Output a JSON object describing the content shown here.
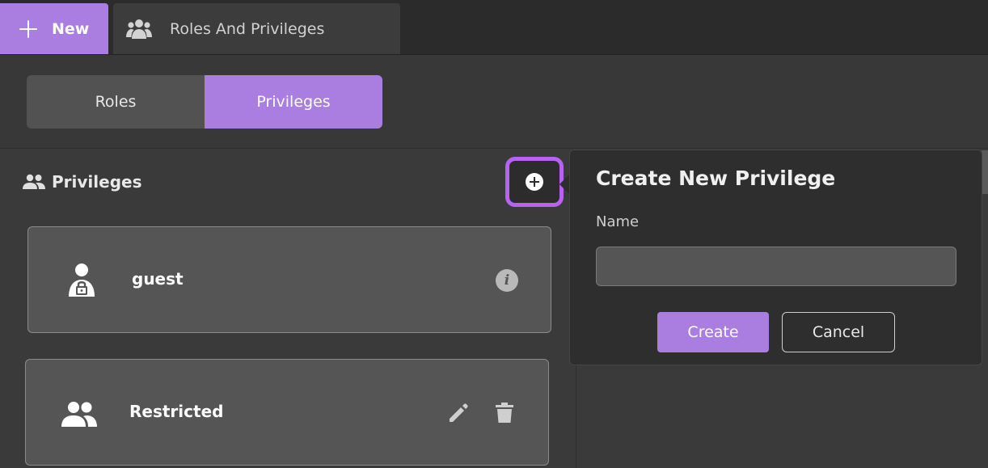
{
  "topbar": {
    "new_label": "New",
    "tab_label": "Roles And Privileges"
  },
  "segment": {
    "roles_label": "Roles",
    "privileges_label": "Privileges",
    "active": "Privileges"
  },
  "panel": {
    "title": "Privileges",
    "items": [
      {
        "label": "guest",
        "icon": "user-lock-icon",
        "actions": [
          "info-icon"
        ]
      },
      {
        "label": "Restricted",
        "icon": "people-icon",
        "actions": [
          "edit-icon",
          "trash-icon"
        ]
      }
    ]
  },
  "popover": {
    "title": "Create New Privilege",
    "name_label": "Name",
    "name_value": "",
    "create_label": "Create",
    "cancel_label": "Cancel"
  },
  "colors": {
    "accent": "#a97ee0",
    "highlight_ring": "#b762f0",
    "background": "#3a3a3a"
  }
}
